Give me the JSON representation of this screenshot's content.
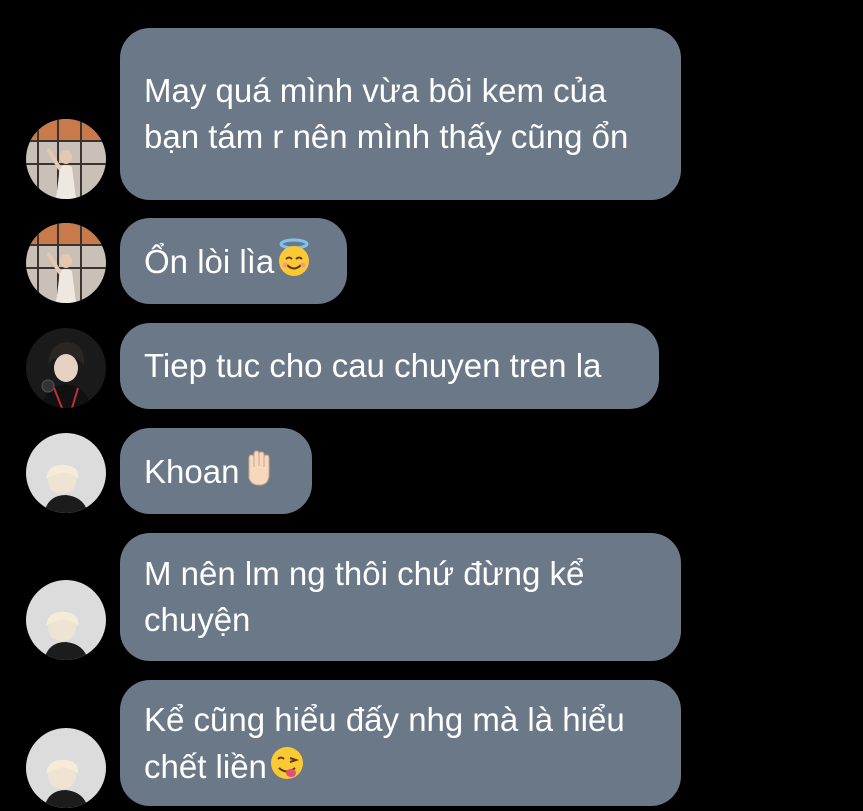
{
  "messages": [
    {
      "text": "May quá mình vừa bôi kem của bạn tám r nên mình thấy cũng ổn",
      "emoji": "",
      "avatar": "avatar-window-girl"
    },
    {
      "text": "Ổn lòi lìa",
      "emoji": "smiling-face-with-halo-emoji",
      "avatar": "avatar-window-girl"
    },
    {
      "text": "Tiep tuc cho cau chuyen tren la",
      "emoji": "",
      "avatar": "avatar-dark-boy"
    },
    {
      "text": "Khoan",
      "emoji": "raised-hand-emoji",
      "avatar": "avatar-blond-boy"
    },
    {
      "text": "M nên lm ng thôi chứ đừng kể chuyện",
      "emoji": "",
      "avatar": "avatar-blond-boy"
    },
    {
      "text": "Kể cũng hiểu đấy nhg mà là hiểu chết liền",
      "emoji": "face-savoring-food-emoji",
      "avatar": "avatar-blond-boy"
    }
  ],
  "colors": {
    "background": "#000000",
    "bubble": "#6b7888",
    "text": "#ffffff"
  }
}
